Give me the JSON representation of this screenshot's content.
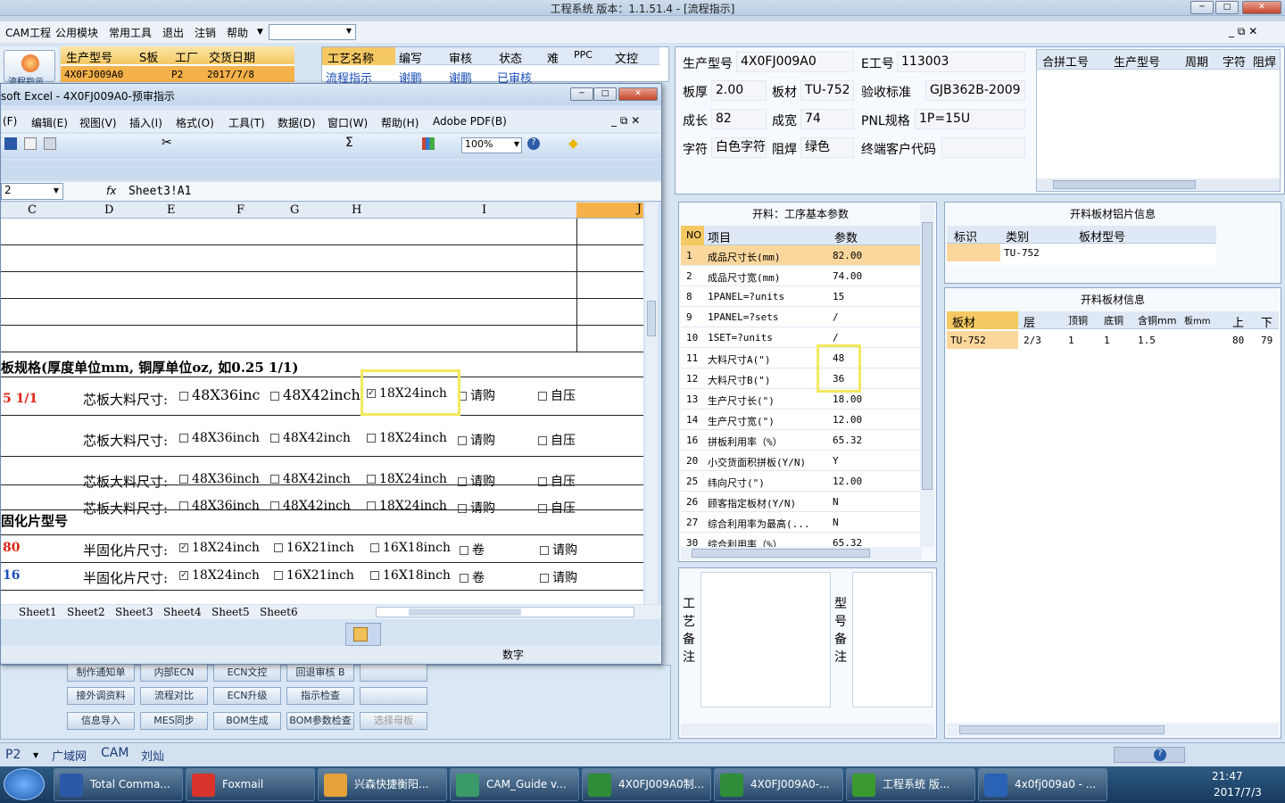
{
  "app": {
    "title": "工程系统  版本：1.1.51.4 - [流程指示]"
  },
  "menu": [
    "CAM工程",
    "公用模块",
    "常用工具",
    "退出",
    "注销",
    "帮助"
  ],
  "left_grid": {
    "headers": [
      "生产型号",
      "S板",
      "工厂",
      "交货日期"
    ],
    "row": [
      "4X0FJ009A0",
      "P2",
      "2017/7/8"
    ],
    "button": "流程指示"
  },
  "flow_grid": {
    "headers": [
      "工艺名称",
      "编写",
      "审核",
      "状态",
      "难",
      "PPC",
      "文控"
    ],
    "row": [
      "流程指示",
      "谢鹏",
      "谢鹏",
      "已审核"
    ]
  },
  "info": {
    "prod_label": "生产型号",
    "prod": "4X0FJ009A0",
    "e_label": "E工号",
    "e": "113003",
    "thick_label": "板厚",
    "thick": "2.00",
    "mat_label": "板材",
    "mat": "TU-752",
    "std_label": "验收标准",
    "std": "GJB362B-2009",
    "len_label": "成长",
    "len": "82",
    "wid_label": "成宽",
    "wid": "74",
    "pnl_label": "PNL规格",
    "pnl": "1P=15U",
    "char_label": "字符",
    "char": "白色字符",
    "mask_label": "阻焊",
    "mask": "绿色",
    "cust_label": "终端客户代码",
    "cust": ""
  },
  "right_grid": {
    "headers": [
      "合拼工号",
      "生产型号",
      "周期",
      "字符",
      "阻焊"
    ]
  },
  "params": {
    "title": "开料：工序基本参数",
    "headers": [
      "NO",
      "项目",
      "参数"
    ],
    "rows": [
      [
        "1",
        "成品尺寸长(mm)",
        "82.00"
      ],
      [
        "2",
        "成品尺寸宽(mm)",
        "74.00"
      ],
      [
        "8",
        "1PANEL=?units",
        "15"
      ],
      [
        "9",
        "1PANEL=?sets",
        "/"
      ],
      [
        "10",
        "1SET=?units",
        "/"
      ],
      [
        "11",
        "大料尺寸A(\")",
        "48"
      ],
      [
        "12",
        "大料尺寸B(\")",
        "36"
      ],
      [
        "13",
        "生产尺寸长(\")",
        "18.00"
      ],
      [
        "14",
        "生产尺寸宽(\")",
        "12.00"
      ],
      [
        "16",
        "拼板利用率（%）",
        "65.32"
      ],
      [
        "20",
        "小交货面积拼板(Y/N)",
        "Y"
      ],
      [
        "25",
        "纬向尺寸(\")",
        "12.00"
      ],
      [
        "26",
        "顾客指定板材(Y/N)",
        "N"
      ],
      [
        "27",
        "综合利用率为最高(...",
        "N"
      ],
      [
        "30",
        "综合利用率（%）",
        "65.32"
      ]
    ]
  },
  "alu": {
    "title": "开料板材铝片信息",
    "headers": [
      "标识",
      "类别",
      "板材型号"
    ],
    "row": [
      "",
      "TU-752",
      ""
    ]
  },
  "board": {
    "title": "开料板材信息",
    "headers": [
      "板材",
      "层",
      "顶铜",
      "底铜",
      "含铜mm",
      "板mm",
      "上",
      "下"
    ],
    "row": [
      "TU-752",
      "2/3",
      "1",
      "1",
      "1.5",
      "",
      "80",
      "79"
    ]
  },
  "notes": {
    "craft": "工艺备注",
    "model": "型号备注"
  },
  "buttons": [
    [
      "制作通知单",
      "内部ECN",
      "ECN文控",
      "回退审核 B",
      ""
    ],
    [
      "接外调资料",
      "流程对比",
      "ECN升级",
      "指示检查",
      ""
    ],
    [
      "信息导入",
      "MES同步",
      "BOM生成",
      "BOM参数检查",
      "选择母板"
    ]
  ],
  "status": {
    "p2": "P2",
    "items": [
      "广域网",
      "CAM",
      "刘灿"
    ]
  },
  "excel": {
    "title": "soft Excel - 4X0FJ009A0-预审指示",
    "menu": [
      "(F)",
      "编辑(E)",
      "视图(V)",
      "插入(I)",
      "格式(O)",
      "工具(T)",
      "数据(D)",
      "窗口(W)",
      "帮助(H)",
      "Adobe PDF(B)"
    ],
    "zoom": "100%",
    "namebox": "2",
    "formula": "Sheet3!A1",
    "cols": [
      "C",
      "D",
      "E",
      "F",
      "G",
      "H",
      "I",
      "J"
    ],
    "sec1": "板规格(厚度单位mm, 铜厚单位oz, 如0.25 1/1)",
    "core_label": "芯板大料尺寸:",
    "core_rows": [
      [
        "48X36inc",
        "48X42inch",
        "18X24inch",
        "请购",
        "自压"
      ],
      [
        "48X36inch",
        "48X42inch",
        "18X24inch",
        "请购",
        "自压"
      ],
      [
        "48X36inch",
        "48X42inch",
        "18X24inch",
        "请购",
        "自压"
      ],
      [
        "48X36inch",
        "48X42inch",
        "18X24inch",
        "请购",
        "自压"
      ]
    ],
    "sec1_val": "5 1/1",
    "sec2": "固化片型号",
    "pp_label": "半固化片尺寸:",
    "pp_rows": [
      [
        "80",
        "18X24inch",
        "16X21inch",
        "16X18inch",
        "卷",
        "请购"
      ],
      [
        "16",
        "18X24inch",
        "16X21inch",
        "16X18inch",
        "卷",
        "请购"
      ]
    ],
    "tabs": [
      "Sheet1",
      "Sheet2",
      "Sheet3",
      "Sheet4",
      "Sheet5",
      "Sheet6"
    ],
    "status": "数字"
  },
  "taskbar": {
    "items": [
      "Total Comma...",
      "Foxmail",
      "兴森快捷衡阳...",
      "CAM_Guide v...",
      "4X0FJ009A0制...",
      "4X0FJ009A0-...",
      "工程系统  版...",
      "4x0fj009a0 - ..."
    ],
    "time": "21:47",
    "date": "2017/7/3"
  }
}
